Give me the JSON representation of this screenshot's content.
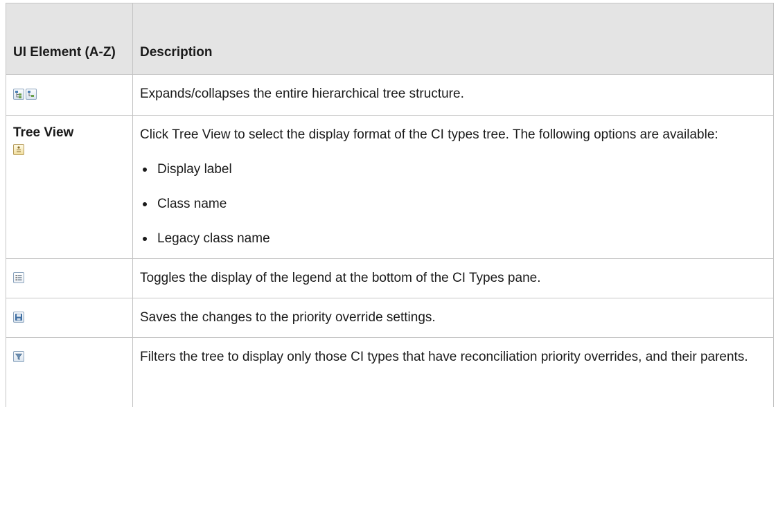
{
  "header": {
    "col1": "UI Element (A-Z)",
    "col2": "Description"
  },
  "rows": [
    {
      "element_label": "",
      "icons": [
        "expand-tree-icon",
        "collapse-tree-icon"
      ],
      "description": "Expands/collapses the entire hierarchical tree structure."
    },
    {
      "element_label": "Tree View",
      "icons": [
        "tree-view-icon"
      ],
      "description": "Click Tree View to select the display format of the CI types tree. The following options are available:",
      "options": [
        "Display label",
        "Class name",
        "Legacy class name"
      ]
    },
    {
      "element_label": "",
      "icons": [
        "legend-icon"
      ],
      "description": "Toggles the display of the legend at the bottom of the CI Types pane."
    },
    {
      "element_label": "",
      "icons": [
        "save-icon"
      ],
      "description": "Saves the changes to the priority override settings."
    },
    {
      "element_label": "",
      "icons": [
        "filter-icon"
      ],
      "description": "Filters the tree to display only those CI types that have reconciliation priority overrides, and their parents."
    }
  ],
  "colors": {
    "header_bg": "#e4e4e4",
    "border": "#c4c4c4",
    "icon_border": "#8aa3bd"
  }
}
